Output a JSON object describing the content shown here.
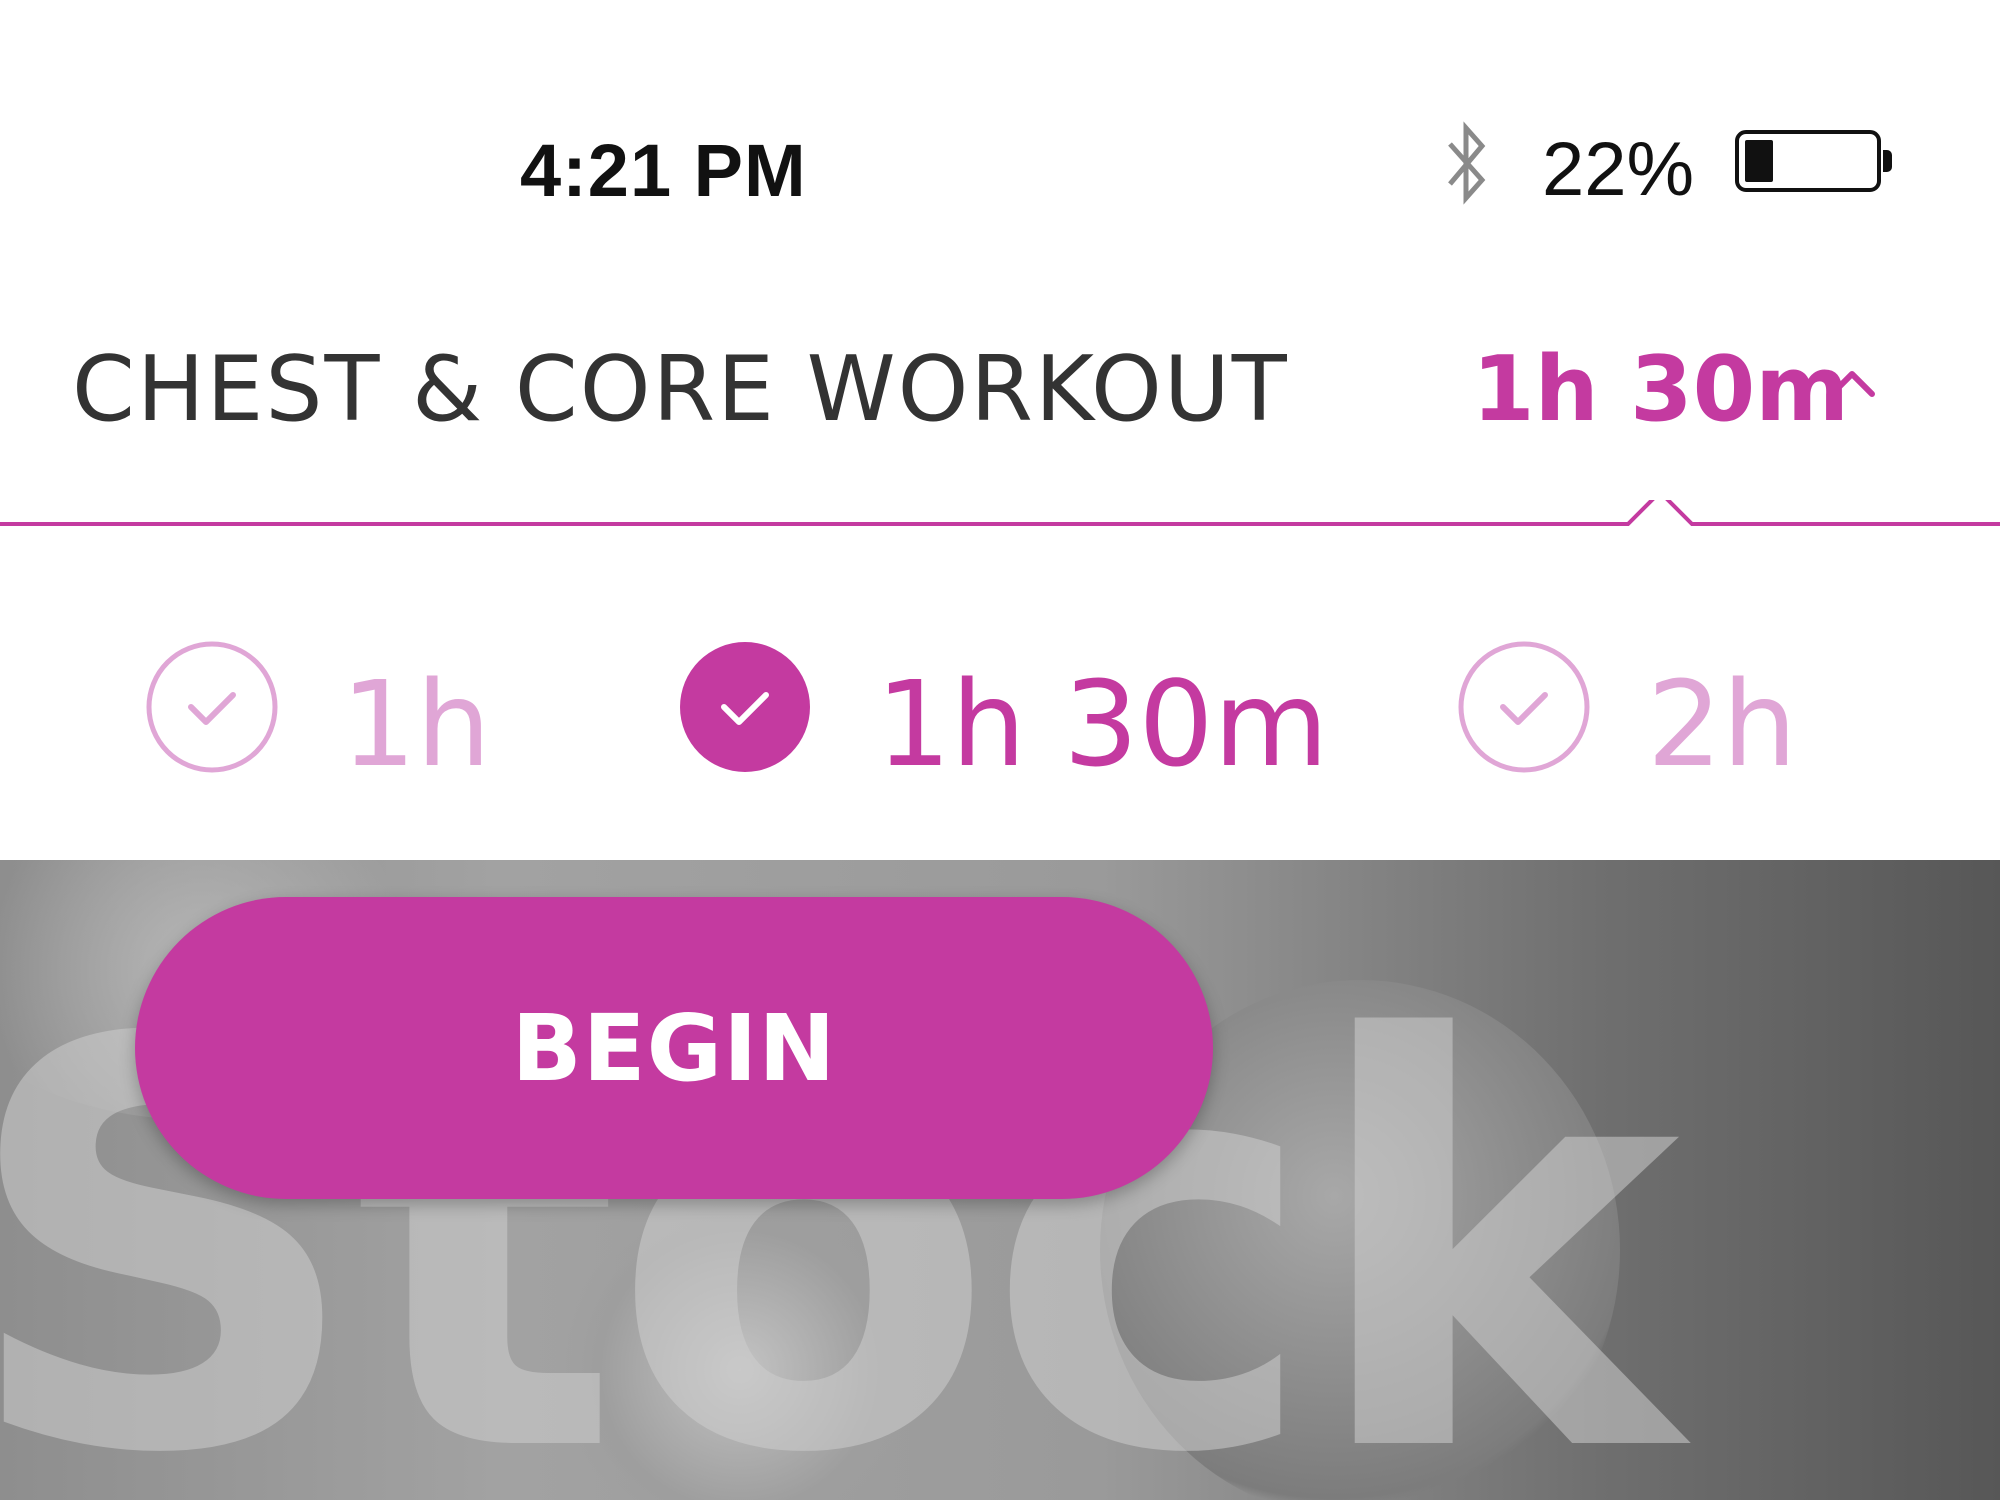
{
  "status_bar": {
    "time": "4:21 PM",
    "battery_percent": "22%",
    "battery_level": 0.22,
    "icons": [
      "bluetooth-icon",
      "battery-icon"
    ]
  },
  "header": {
    "title": "CHEST & CORE WORKOUT",
    "selected_duration": "1h 30m",
    "dropdown_icon": "chevron-up-icon"
  },
  "duration_options": [
    {
      "label": "1h",
      "selected": false
    },
    {
      "label": "1h 30m",
      "selected": true
    },
    {
      "label": "2h",
      "selected": false
    }
  ],
  "begin_label": "BEGIN",
  "background_watermark": "Stock",
  "colors": {
    "accent": "#c43aa0",
    "accent_muted": "#e0a6d6",
    "text_dark": "#333333"
  }
}
